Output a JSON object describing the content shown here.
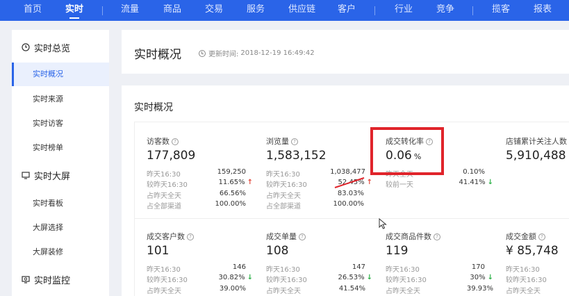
{
  "nav": [
    "首页",
    "实时",
    "流量",
    "商品",
    "交易",
    "服务",
    "供应链",
    "客户",
    "行业",
    "竞争",
    "揽客",
    "报表"
  ],
  "nav_active": "实时",
  "sidebar": {
    "groups": [
      {
        "label": "实时总览",
        "icon": "clock-icon",
        "items": [
          "实时概况",
          "实时来源",
          "实时访客",
          "实时榜单"
        ]
      },
      {
        "label": "实时大屏",
        "icon": "monitor-icon",
        "items": [
          "实时看板",
          "大屏选择",
          "大屏装修"
        ]
      },
      {
        "label": "实时监控",
        "icon": "monitor-watch-icon",
        "items": []
      }
    ],
    "active_item": "实时概况"
  },
  "header": {
    "title": "实时概况",
    "update_prefix": "更新时间:",
    "update_time": "2018-12-19 16:49:42"
  },
  "section_title": "实时概况",
  "help_glyph": "?",
  "metrics_row1": [
    {
      "label": "访客数",
      "value": "177,809",
      "rows": [
        [
          "昨天16:30",
          "159,250"
        ],
        [
          "较昨天16:30",
          "11.65%"
        ],
        [
          "占昨天全天",
          "66.56%"
        ],
        [
          "占全部渠道",
          "100.00%"
        ]
      ],
      "trend": "up"
    },
    {
      "label": "浏览量",
      "value": "1,583,152",
      "rows": [
        [
          "昨天16:30",
          "1,038,477"
        ],
        [
          "较昨天16:30",
          "52.45%"
        ],
        [
          "占昨天全天",
          "83.03%"
        ],
        [
          "占全部渠道",
          "100.00%"
        ]
      ],
      "trend": "up"
    },
    {
      "label": "成交转化率",
      "value": "0.06",
      "unit": "%",
      "rows": [
        [
          "昨天全天",
          "0.10%"
        ],
        [
          "较前一天",
          "41.41%"
        ]
      ],
      "trend": "down"
    },
    {
      "label": "店铺累计关注人数",
      "value": "5,910,488",
      "rows": []
    }
  ],
  "metrics_row2": [
    {
      "label": "成交客户数",
      "value": "101",
      "rows": [
        [
          "昨天16:30",
          "146"
        ],
        [
          "较昨天16:30",
          "30.82%"
        ],
        [
          "占昨天全天",
          "39.00%"
        ]
      ],
      "trend": "down"
    },
    {
      "label": "成交单量",
      "value": "108",
      "rows": [
        [
          "昨天16:30",
          "147"
        ],
        [
          "较昨天16:30",
          "26.53%"
        ],
        [
          "占昨天全天",
          "41.54%"
        ]
      ],
      "trend": "down"
    },
    {
      "label": "成交商品件数",
      "value": "119",
      "rows": [
        [
          "昨天16:30",
          "170"
        ],
        [
          "较昨天16:30",
          "30%"
        ],
        [
          "占昨天全天",
          "39.93%"
        ]
      ],
      "trend": "down"
    },
    {
      "label": "成交金额",
      "value": "¥ 85,748",
      "rows": [
        [
          "昨天16:30",
          ""
        ],
        [
          "较昨天16:30",
          ""
        ],
        [
          "占昨天全天",
          ""
        ]
      ]
    }
  ],
  "colors": {
    "nav_bg": "#2a64e8",
    "up": "#e34b3d",
    "down": "#2fb24a",
    "highlight": "#e0242b"
  }
}
